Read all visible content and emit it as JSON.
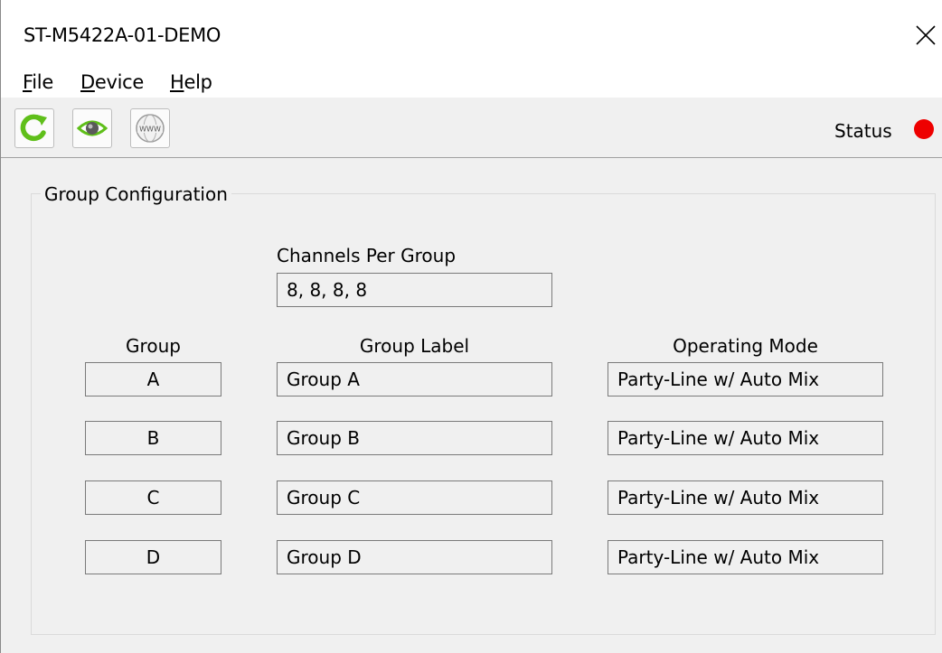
{
  "window": {
    "title": "ST-M5422A-01-DEMO"
  },
  "menu": [
    {
      "label_u": "F",
      "label_rest": "ile"
    },
    {
      "label_u": "D",
      "label_rest": "evice"
    },
    {
      "label_u": "H",
      "label_rest": "elp"
    }
  ],
  "toolbar": {
    "buttons": [
      "refresh-icon",
      "eye-icon",
      "www-icon"
    ],
    "status_label": "Status",
    "status_color": "#ee0000"
  },
  "group_config": {
    "title": "Group Configuration",
    "channels_label": "Channels Per Group",
    "channels_value": "8, 8, 8, 8",
    "col_group": "Group",
    "col_label": "Group Label",
    "col_mode": "Operating Mode",
    "rows": [
      {
        "group": "A",
        "label": "Group A",
        "mode": "Party-Line w/ Auto Mix"
      },
      {
        "group": "B",
        "label": "Group B",
        "mode": "Party-Line w/ Auto Mix"
      },
      {
        "group": "C",
        "label": "Group C",
        "mode": "Party-Line w/ Auto Mix"
      },
      {
        "group": "D",
        "label": "Group D",
        "mode": "Party-Line w/ Auto Mix"
      }
    ]
  }
}
